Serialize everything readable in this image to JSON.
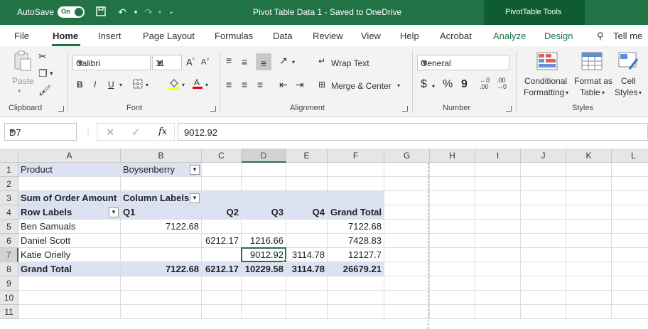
{
  "titlebar": {
    "autosave_label": "AutoSave",
    "toggle_label": "On",
    "doc_title": "Pivot Table Data 1  -  Saved to OneDrive",
    "contextual_tab": "PivotTable Tools"
  },
  "tabs": [
    "File",
    "Home",
    "Insert",
    "Page Layout",
    "Formulas",
    "Data",
    "Review",
    "View",
    "Help",
    "Acrobat",
    "Analyze",
    "Design",
    "Tell me"
  ],
  "ribbon": {
    "clipboard": {
      "label": "Clipboard",
      "paste": "Paste"
    },
    "font": {
      "label": "Font",
      "font_name": "Calibri",
      "font_size": "11",
      "bold": "B",
      "italic": "I",
      "underline": "U"
    },
    "alignment": {
      "label": "Alignment",
      "wrap_text": "Wrap Text",
      "merge_center": "Merge & Center"
    },
    "number": {
      "label": "Number",
      "format": "General",
      "currency": "$",
      "percent": "%",
      "comma": "9"
    },
    "styles": {
      "label": "Styles",
      "conditional_1": "Conditional",
      "conditional_2": "Formatting",
      "format_as_1": "Format as",
      "format_as_2": "Table",
      "cell_1": "Cell",
      "cell_2": "Styles"
    }
  },
  "formula_bar": {
    "name_box": "D7",
    "fx": "fx",
    "value": "9012.92"
  },
  "grid": {
    "columns": [
      "A",
      "B",
      "C",
      "D",
      "E",
      "F",
      "G",
      "H",
      "I",
      "J",
      "K",
      "L"
    ],
    "rows": [
      "1",
      "2",
      "3",
      "4",
      "5",
      "6",
      "7",
      "8",
      "9",
      "10",
      "11"
    ],
    "selected_cell": "D7",
    "cells": {
      "A1": "Product",
      "B1": "Boysenberry",
      "A3": "Sum of Order Amount",
      "B3": "Column Labels",
      "A4": "Row Labels",
      "B4": "Q1",
      "C4": "Q2",
      "D4": "Q3",
      "E4": "Q4",
      "F4": "Grand Total",
      "A5": "Ben Samuals",
      "B5": "7122.68",
      "F5": "7122.68",
      "A6": "Daniel Scott",
      "C6": "6212.17",
      "D6": "1216.66",
      "F6": "7428.83",
      "A7": "Katie Orielly",
      "D7": "9012.92",
      "E7": "3114.78",
      "F7": "12127.7",
      "A8": "Grand Total",
      "B8": "7122.68",
      "C8": "6212.17",
      "D8": "10229.58",
      "E8": "3114.78",
      "F8": "26679.21"
    }
  },
  "colors": {
    "excel_green": "#217346",
    "pivot_header": "#dbe3f3"
  }
}
